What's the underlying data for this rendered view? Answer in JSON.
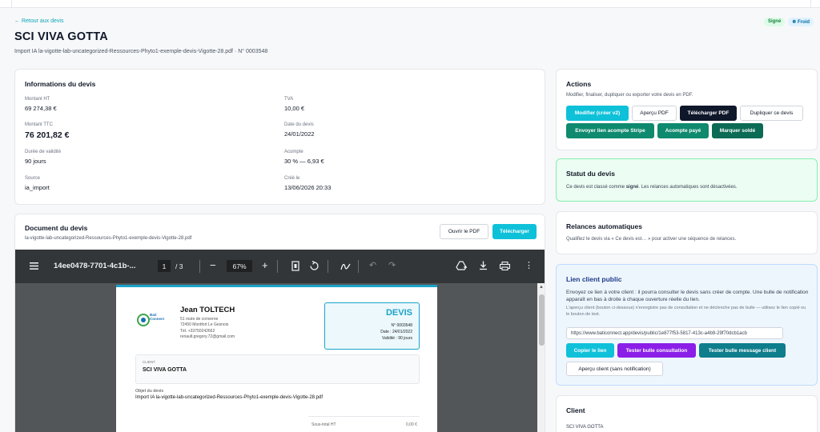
{
  "header": {
    "back_label": "← Retour aux devis",
    "title": "SCI VIVA GOTTA",
    "subtitle": "Import IA la-vigotte-lab-uncategorized-Ressources-Phyto1-exemple-devis-Vigotte-28.pdf · N° 0003548",
    "badge_signed": "Signé",
    "badge_cold": "❄ Froid"
  },
  "info": {
    "title": "Informations du devis",
    "montant_ht_label": "Montant HT",
    "montant_ht": "69 274,38 €",
    "tva_label": "TVA",
    "tva": "10,00 €",
    "montant_ttc_label": "Montant TTC",
    "montant_ttc": "76 201,82 €",
    "date_label": "Date du devis",
    "date": "24/01/2022",
    "validite_label": "Durée de validité",
    "validite": "90 jours",
    "acompte_label": "Acompte",
    "acompte": "30 % — 6,93 €",
    "source_label": "Source",
    "source": "ia_import",
    "cree_label": "Créé le",
    "cree": "13/06/2026 20:33"
  },
  "document": {
    "title": "Document du devis",
    "filename": "la-vigotte-lab-uncategorized-Ressources-Phyto1-exemple-devis-Vigotte-28.pdf",
    "open_pdf": "Ouvrir le PDF",
    "download": "Télécharger"
  },
  "viewer": {
    "file_name": "14ee0478-7701-4c1b-...",
    "page_current": "1",
    "page_total": "/ 3",
    "zoom": "67%"
  },
  "pdf": {
    "company": "Jean TOLTECH",
    "addr1": "51 route de converne",
    "addr2": "72450 Montfort Le Gesnois",
    "tel": "Tél. +33750242662",
    "email": "renault.gregory.72@gmail.com",
    "logo_text_1": "Bati",
    "logo_text_2": "Connect",
    "devis_title": "DEVIS",
    "devis_number": "N° 0003548",
    "devis_date": "Date : 24/01/2022",
    "devis_validite": "Validité : 90 jours",
    "client_label": "CLIENT",
    "client_name": "SCI VIVA GOTTA",
    "objet_label": "Objet du devis",
    "objet_value": "Import IA la-vigotte-lab-uncategorized-Ressources-Phyto1-exemple-devis-Vigotte-28.pdf",
    "sous_total_label": "Sous-total HT",
    "sous_total_value": "0,00 €"
  },
  "actions": {
    "title": "Actions",
    "desc": "Modifier, finaliser, dupliquer ou exporter votre devis en PDF.",
    "modifier": "Modifier (créer v2)",
    "apercu": "Aperçu PDF",
    "telecharger": "Télécharger PDF",
    "dupliquer": "Dupliquer ce devis",
    "envoyer": "Envoyer lien acompte Stripe",
    "acompte_paye": "Acompte payé",
    "marquer": "Marquer soldé"
  },
  "statut": {
    "title": "Statut du devis",
    "desc_pre": "Ce devis est classé comme ",
    "desc_bold": "signé",
    "desc_post": ". Les relances automatiques sont désactivées."
  },
  "relances": {
    "title": "Relances automatiques",
    "desc": "Qualifiez le devis via « Ce devis est… » pour activer une séquence de relances."
  },
  "lien": {
    "title": "Lien client public",
    "desc": "Envoyez ce lien à votre client : il pourra consulter le devis sans créer de compte. Une bulle de notification apparaît en bas à droite à chaque ouverture réelle du lien.",
    "note": "L'aperçu client (bouton ci-dessous) n'enregistre pas de consultation et ne déclenche pas de bulle — utilisez le lien copié ou le bouton de test.",
    "url": "https://www.baticonnect.app/devis/public/1e877f53-5817-413c-a4b9-29f70dcb1acb",
    "copier": "Copier le lien",
    "tester_consultation": "Tester bulle consultation",
    "tester_message": "Tester bulle message client",
    "apercu_client": "Aperçu client (sans notification)"
  },
  "client": {
    "title": "Client",
    "name": "SCI VIVA GOTTA"
  },
  "colors": {
    "accent": "#0ec1d9",
    "dark": "#0f172a",
    "green": "#0f8a6e",
    "purple": "#8b1fe8",
    "pdf_blue": "#1aa3c8"
  }
}
